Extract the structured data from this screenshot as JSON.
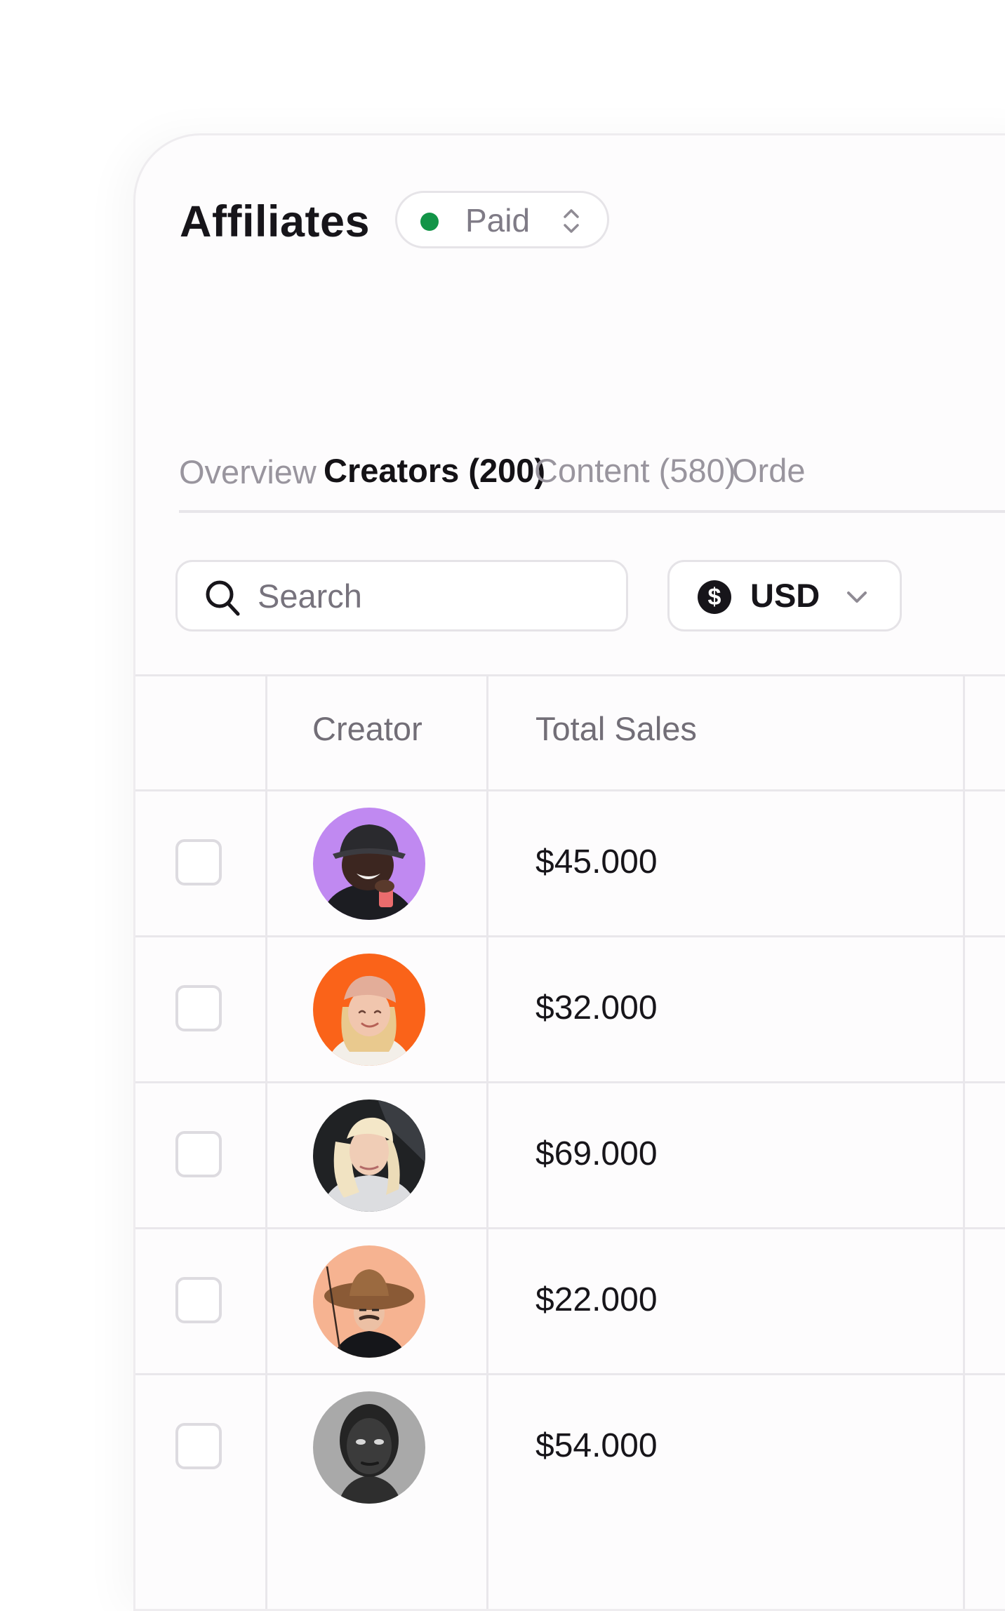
{
  "page": {
    "title": "Affiliates"
  },
  "status": {
    "label": "Paid",
    "color": "#129447"
  },
  "tabs": [
    {
      "label": "Overview",
      "active": false
    },
    {
      "label": "Creators (200)",
      "active": true
    },
    {
      "label": "Content (580)",
      "active": false
    },
    {
      "label": "Orde",
      "active": false
    }
  ],
  "search": {
    "placeholder": "Search",
    "value": ""
  },
  "currency": {
    "symbol": "$",
    "label": "USD"
  },
  "table": {
    "columns": [
      "Creator",
      "Total Sales"
    ],
    "rows": [
      {
        "avatar_bg": "#c089f1",
        "total_sales": "$45.000"
      },
      {
        "avatar_bg": "#fa6319",
        "total_sales": "$32.000"
      },
      {
        "avatar_bg": "#202224",
        "total_sales": "$69.000"
      },
      {
        "avatar_bg": "#f6b391",
        "total_sales": "$22.000"
      },
      {
        "avatar_bg": "#a9a9a9",
        "total_sales": "$54.000"
      }
    ]
  }
}
